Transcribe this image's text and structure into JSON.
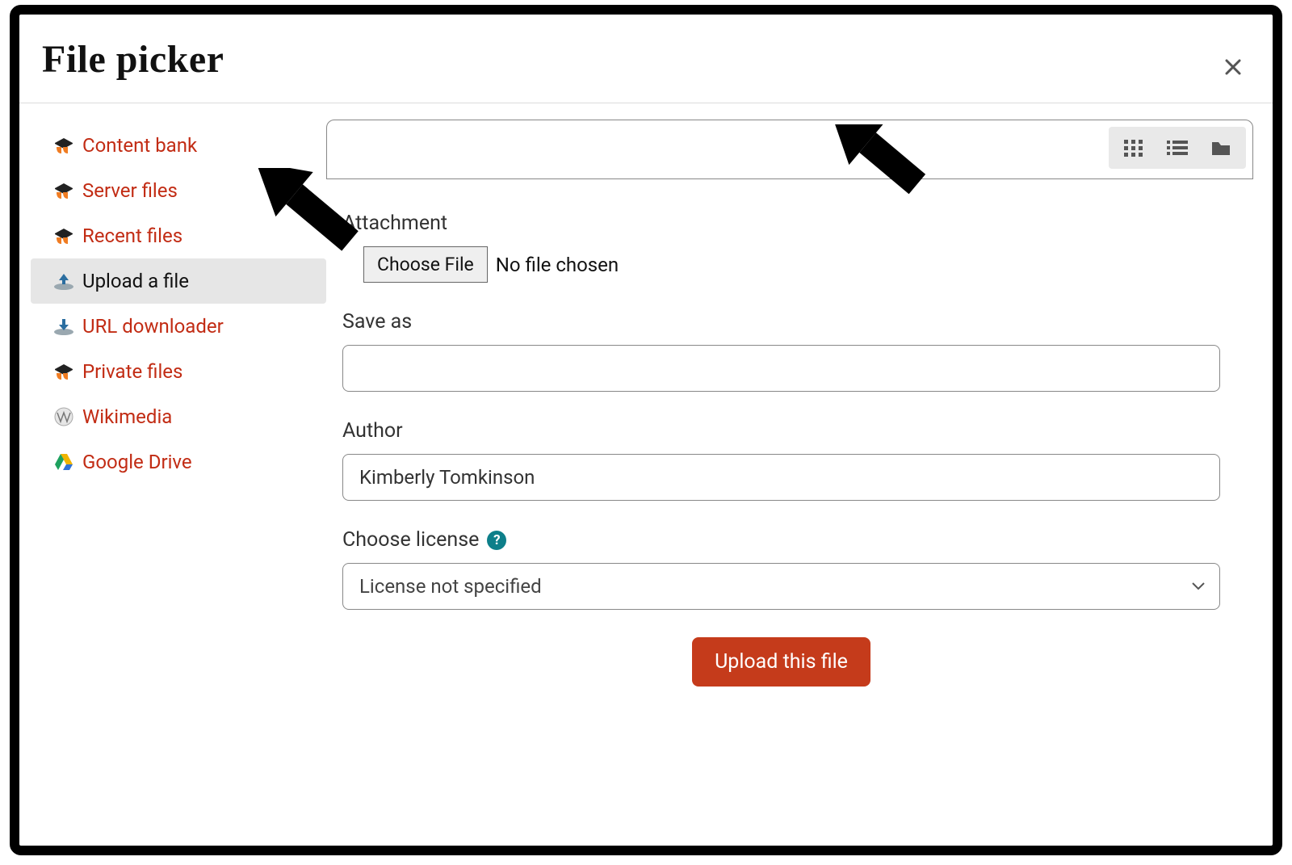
{
  "header": {
    "title": "File picker"
  },
  "sidebar": {
    "items": [
      {
        "label": "Content bank",
        "icon": "moodle"
      },
      {
        "label": "Server files",
        "icon": "moodle"
      },
      {
        "label": "Recent files",
        "icon": "moodle"
      },
      {
        "label": "Upload a file",
        "icon": "upload",
        "active": true
      },
      {
        "label": "URL downloader",
        "icon": "download"
      },
      {
        "label": "Private files",
        "icon": "moodle"
      },
      {
        "label": "Wikimedia",
        "icon": "wiki"
      },
      {
        "label": "Google Drive",
        "icon": "gdrive"
      }
    ]
  },
  "form": {
    "attachment_label": "Attachment",
    "choose_file_button": "Choose File",
    "no_file_text": "No file chosen",
    "save_as_label": "Save as",
    "save_as_value": "",
    "author_label": "Author",
    "author_value": "Kimberly Tomkinson",
    "license_label": "Choose license",
    "license_value": "License not specified",
    "upload_button": "Upload this file"
  }
}
